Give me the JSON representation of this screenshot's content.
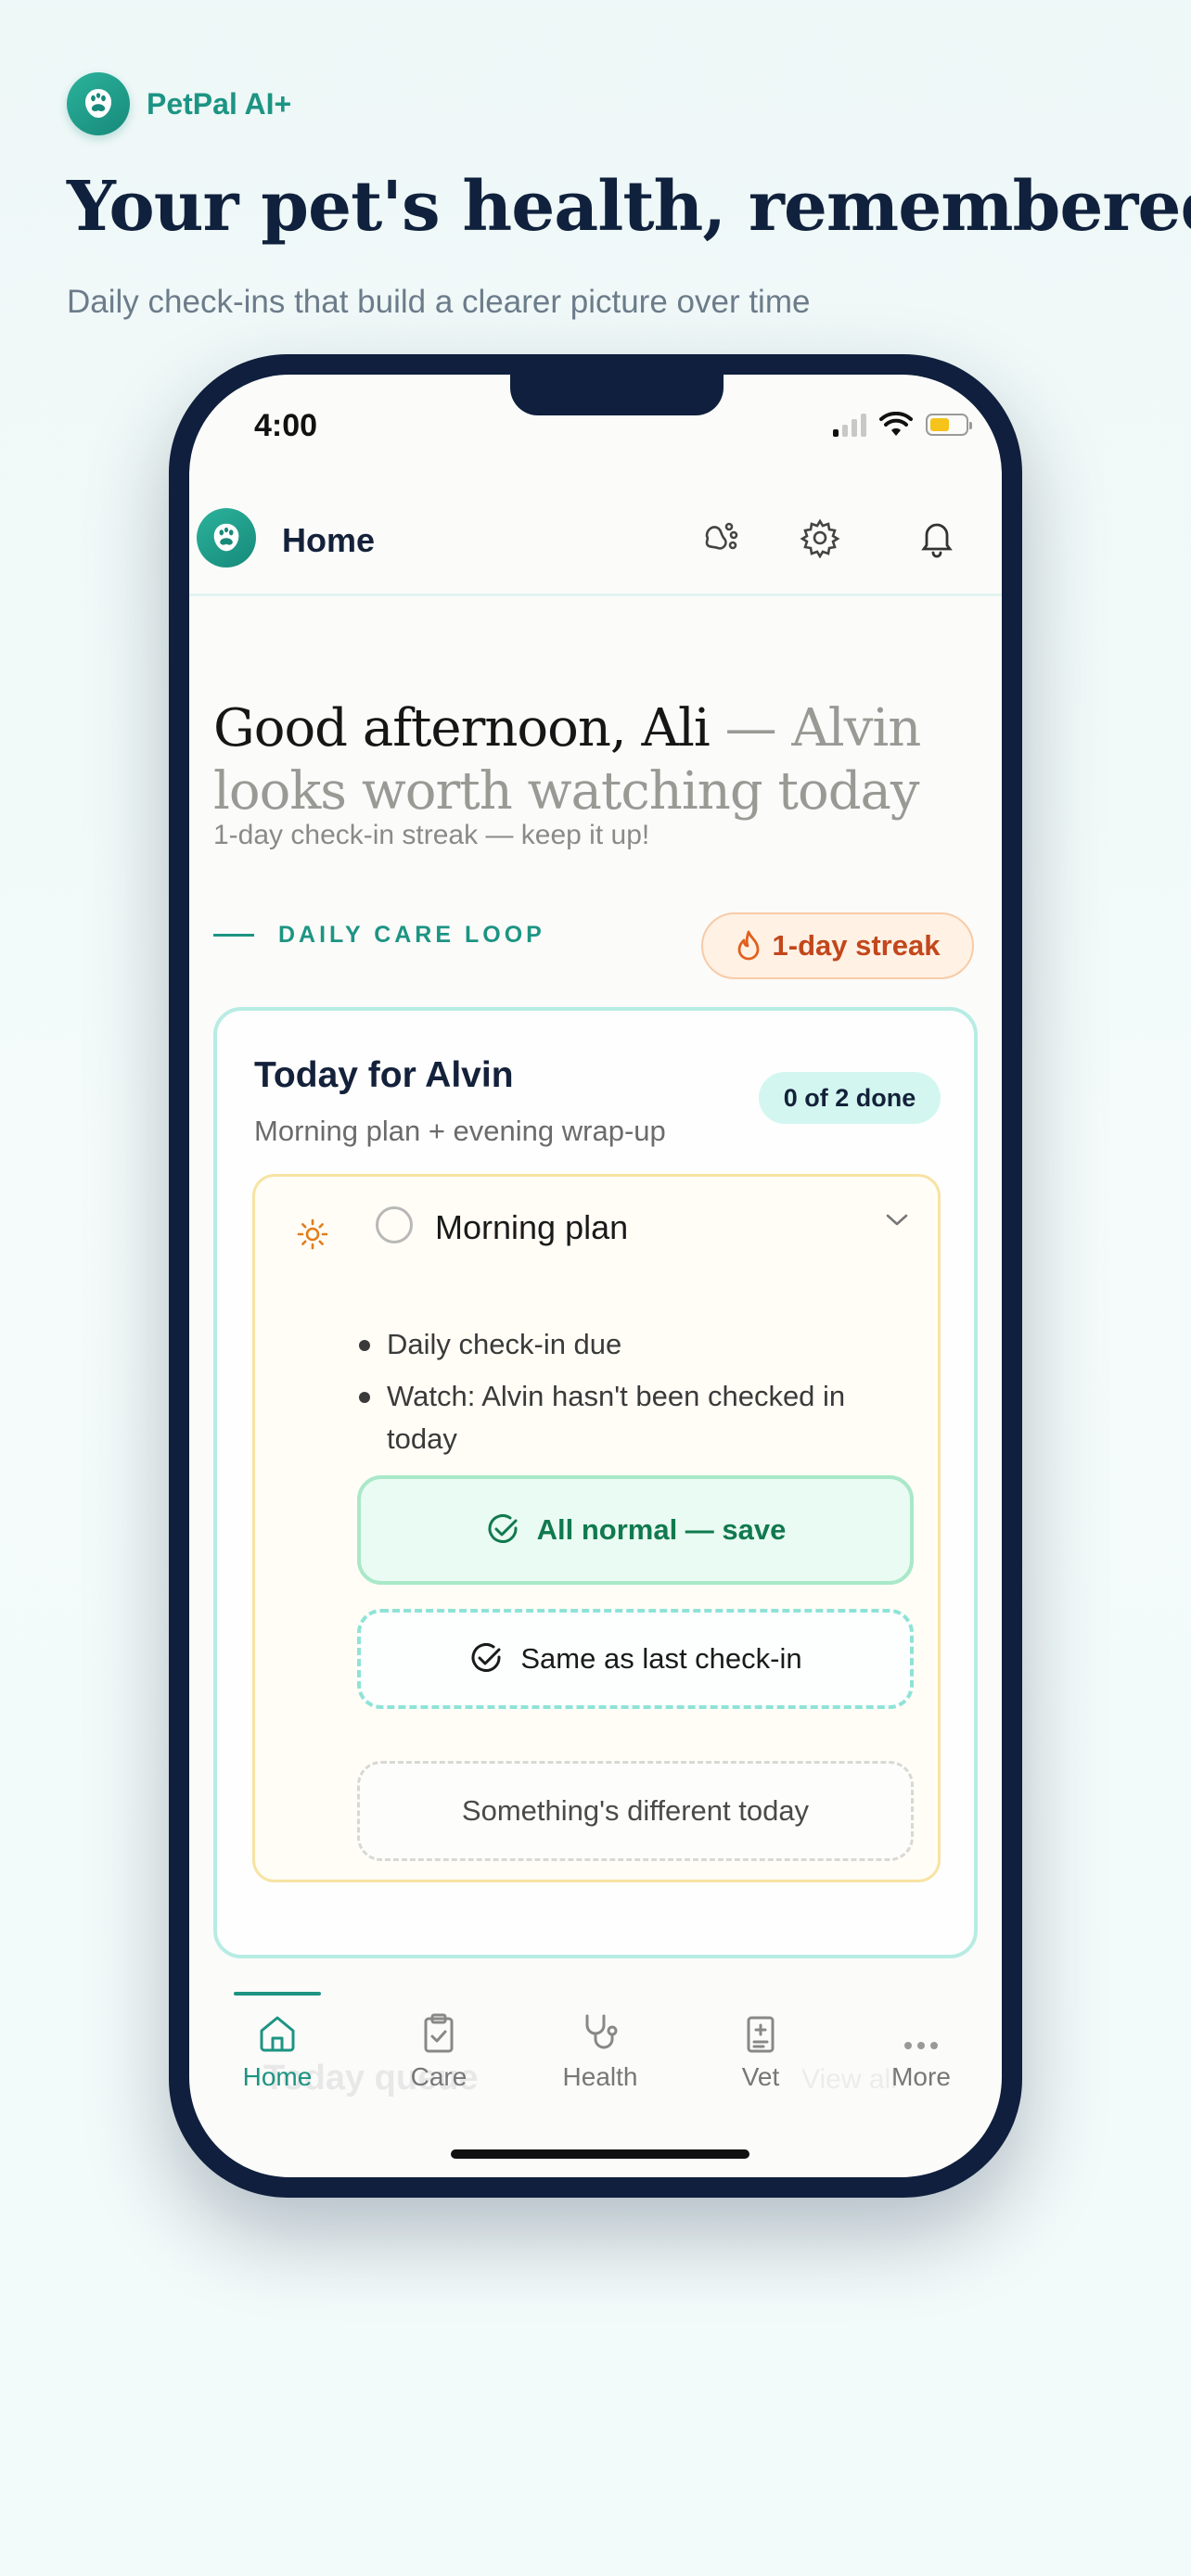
{
  "brand": {
    "name": "PetPal AI+"
  },
  "hero": {
    "title": "Your pet's health, remembered",
    "subtitle": "Daily check-ins that build a clearer picture over time"
  },
  "status_bar": {
    "time": "4:00"
  },
  "app_bar": {
    "title": "Home",
    "icons": [
      "paw-icon",
      "gear-icon",
      "bell-icon"
    ]
  },
  "greeting": {
    "main": "Good afternoon, Ali",
    "muted": " — Alvin looks worth watching today",
    "streak_note": "1-day check-in streak — keep it up!"
  },
  "section": {
    "label": "DAILY CARE LOOP",
    "streak_badge": "1-day streak"
  },
  "today_card": {
    "title": "Today for Alvin",
    "subtitle": "Morning plan + evening wrap-up",
    "progress_badge": "0 of 2 done",
    "plan": {
      "title": "Morning plan",
      "items": [
        "Daily check-in due",
        "Watch: Alvin hasn't been checked in today"
      ],
      "actions": {
        "all_normal": "All normal — save",
        "same_as_last": "Same as last check-in",
        "something_different": "Something's different today"
      }
    }
  },
  "background_section": {
    "title": "Today queue",
    "link": "View all"
  },
  "tabs": [
    {
      "label": "Home",
      "icon": "home-icon",
      "active": true
    },
    {
      "label": "Care",
      "icon": "clipboard-icon",
      "active": false
    },
    {
      "label": "Health",
      "icon": "stethoscope-icon",
      "active": false
    },
    {
      "label": "Vet",
      "icon": "medical-bag-icon",
      "active": false
    },
    {
      "label": "More",
      "icon": "more-icon",
      "active": false
    }
  ],
  "colors": {
    "brand_teal": "#1d9483",
    "navy": "#10213d",
    "streak_orange": "#c2471b",
    "success_green": "#11794f"
  }
}
